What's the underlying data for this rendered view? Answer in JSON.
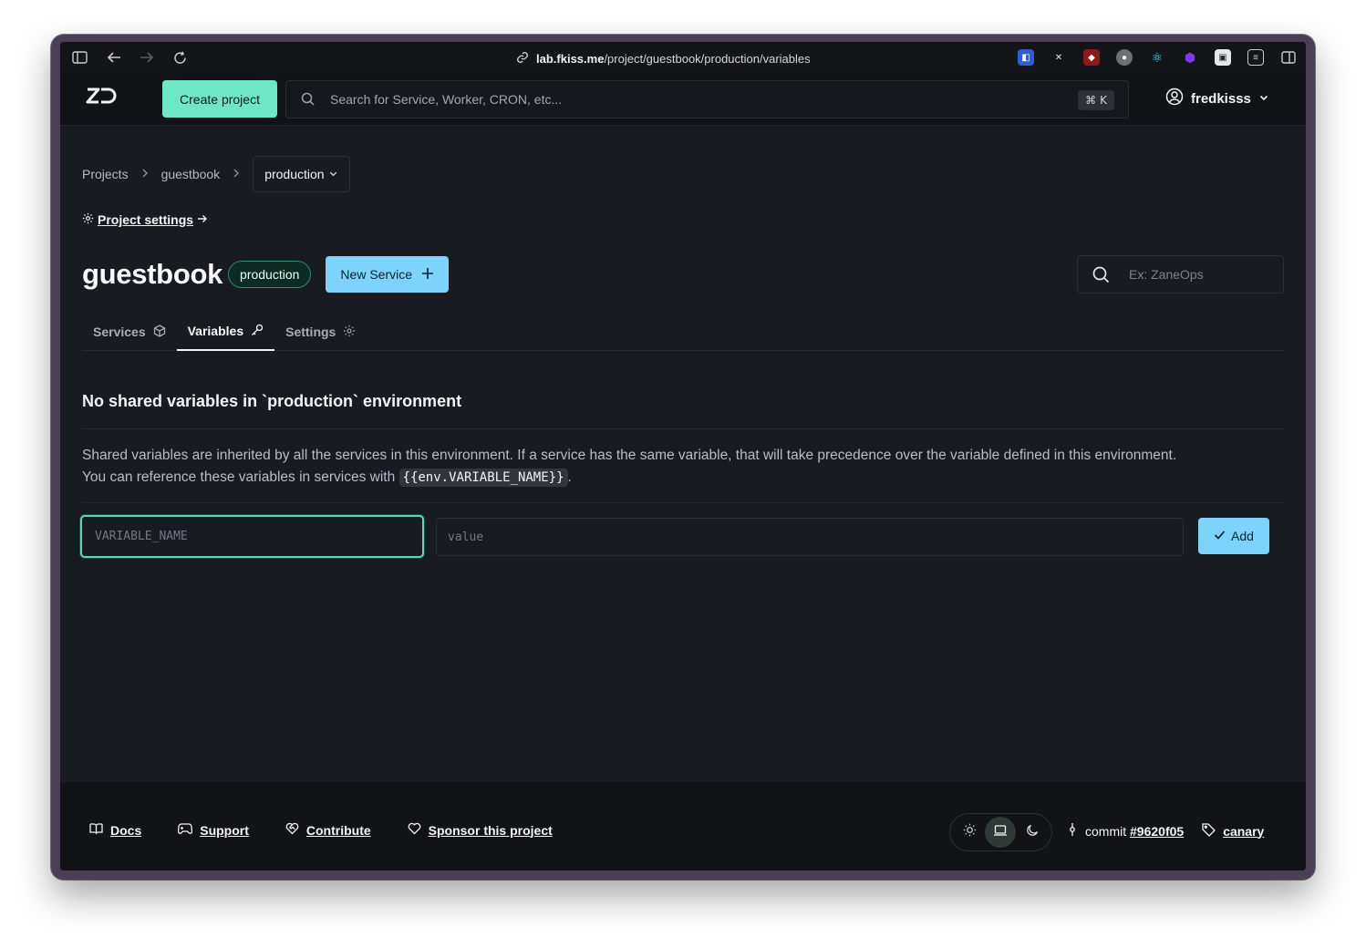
{
  "browser": {
    "url_host": "lab.fkiss.me",
    "url_path": "/project/guestbook/production/variables"
  },
  "header": {
    "logo_text": "ZO",
    "create_label": "Create project",
    "search_placeholder": "Search for Service, Worker, CRON, etc...",
    "shortcut_symbol": "⌘",
    "shortcut_key": "K",
    "username": "fredkisss"
  },
  "breadcrumb": {
    "projects": "Projects",
    "project": "guestbook",
    "environment": "production"
  },
  "project_settings_label": "Project settings",
  "title": {
    "name": "guestbook",
    "env_badge": "production",
    "new_service_label": "New Service",
    "filter_placeholder": "Ex: ZaneOps"
  },
  "tabs": [
    {
      "label": "Services"
    },
    {
      "label": "Variables"
    },
    {
      "label": "Settings"
    }
  ],
  "variables": {
    "empty_title": "No shared variables in `production` environment",
    "description_line1": "Shared variables are inherited by all the services in this environment. If a service has the same variable, that will take precedence over the variable defined in this environment.",
    "description_line2_prefix": "You can reference these variables in services with ",
    "code_snippet": "{{env.VARIABLE_NAME}}",
    "description_line2_suffix": ".",
    "name_placeholder": "VARIABLE_NAME",
    "value_placeholder": "value",
    "add_label": "Add"
  },
  "footer": {
    "docs": "Docs",
    "support": "Support",
    "contribute": "Contribute",
    "sponsor": "Sponsor this project",
    "commit_label": "commit",
    "commit_hash": "#9620f05",
    "channel": "canary"
  },
  "colors": {
    "accent_green": "#6ee7c7",
    "accent_blue": "#7dd3fc",
    "background": "#191b23"
  }
}
